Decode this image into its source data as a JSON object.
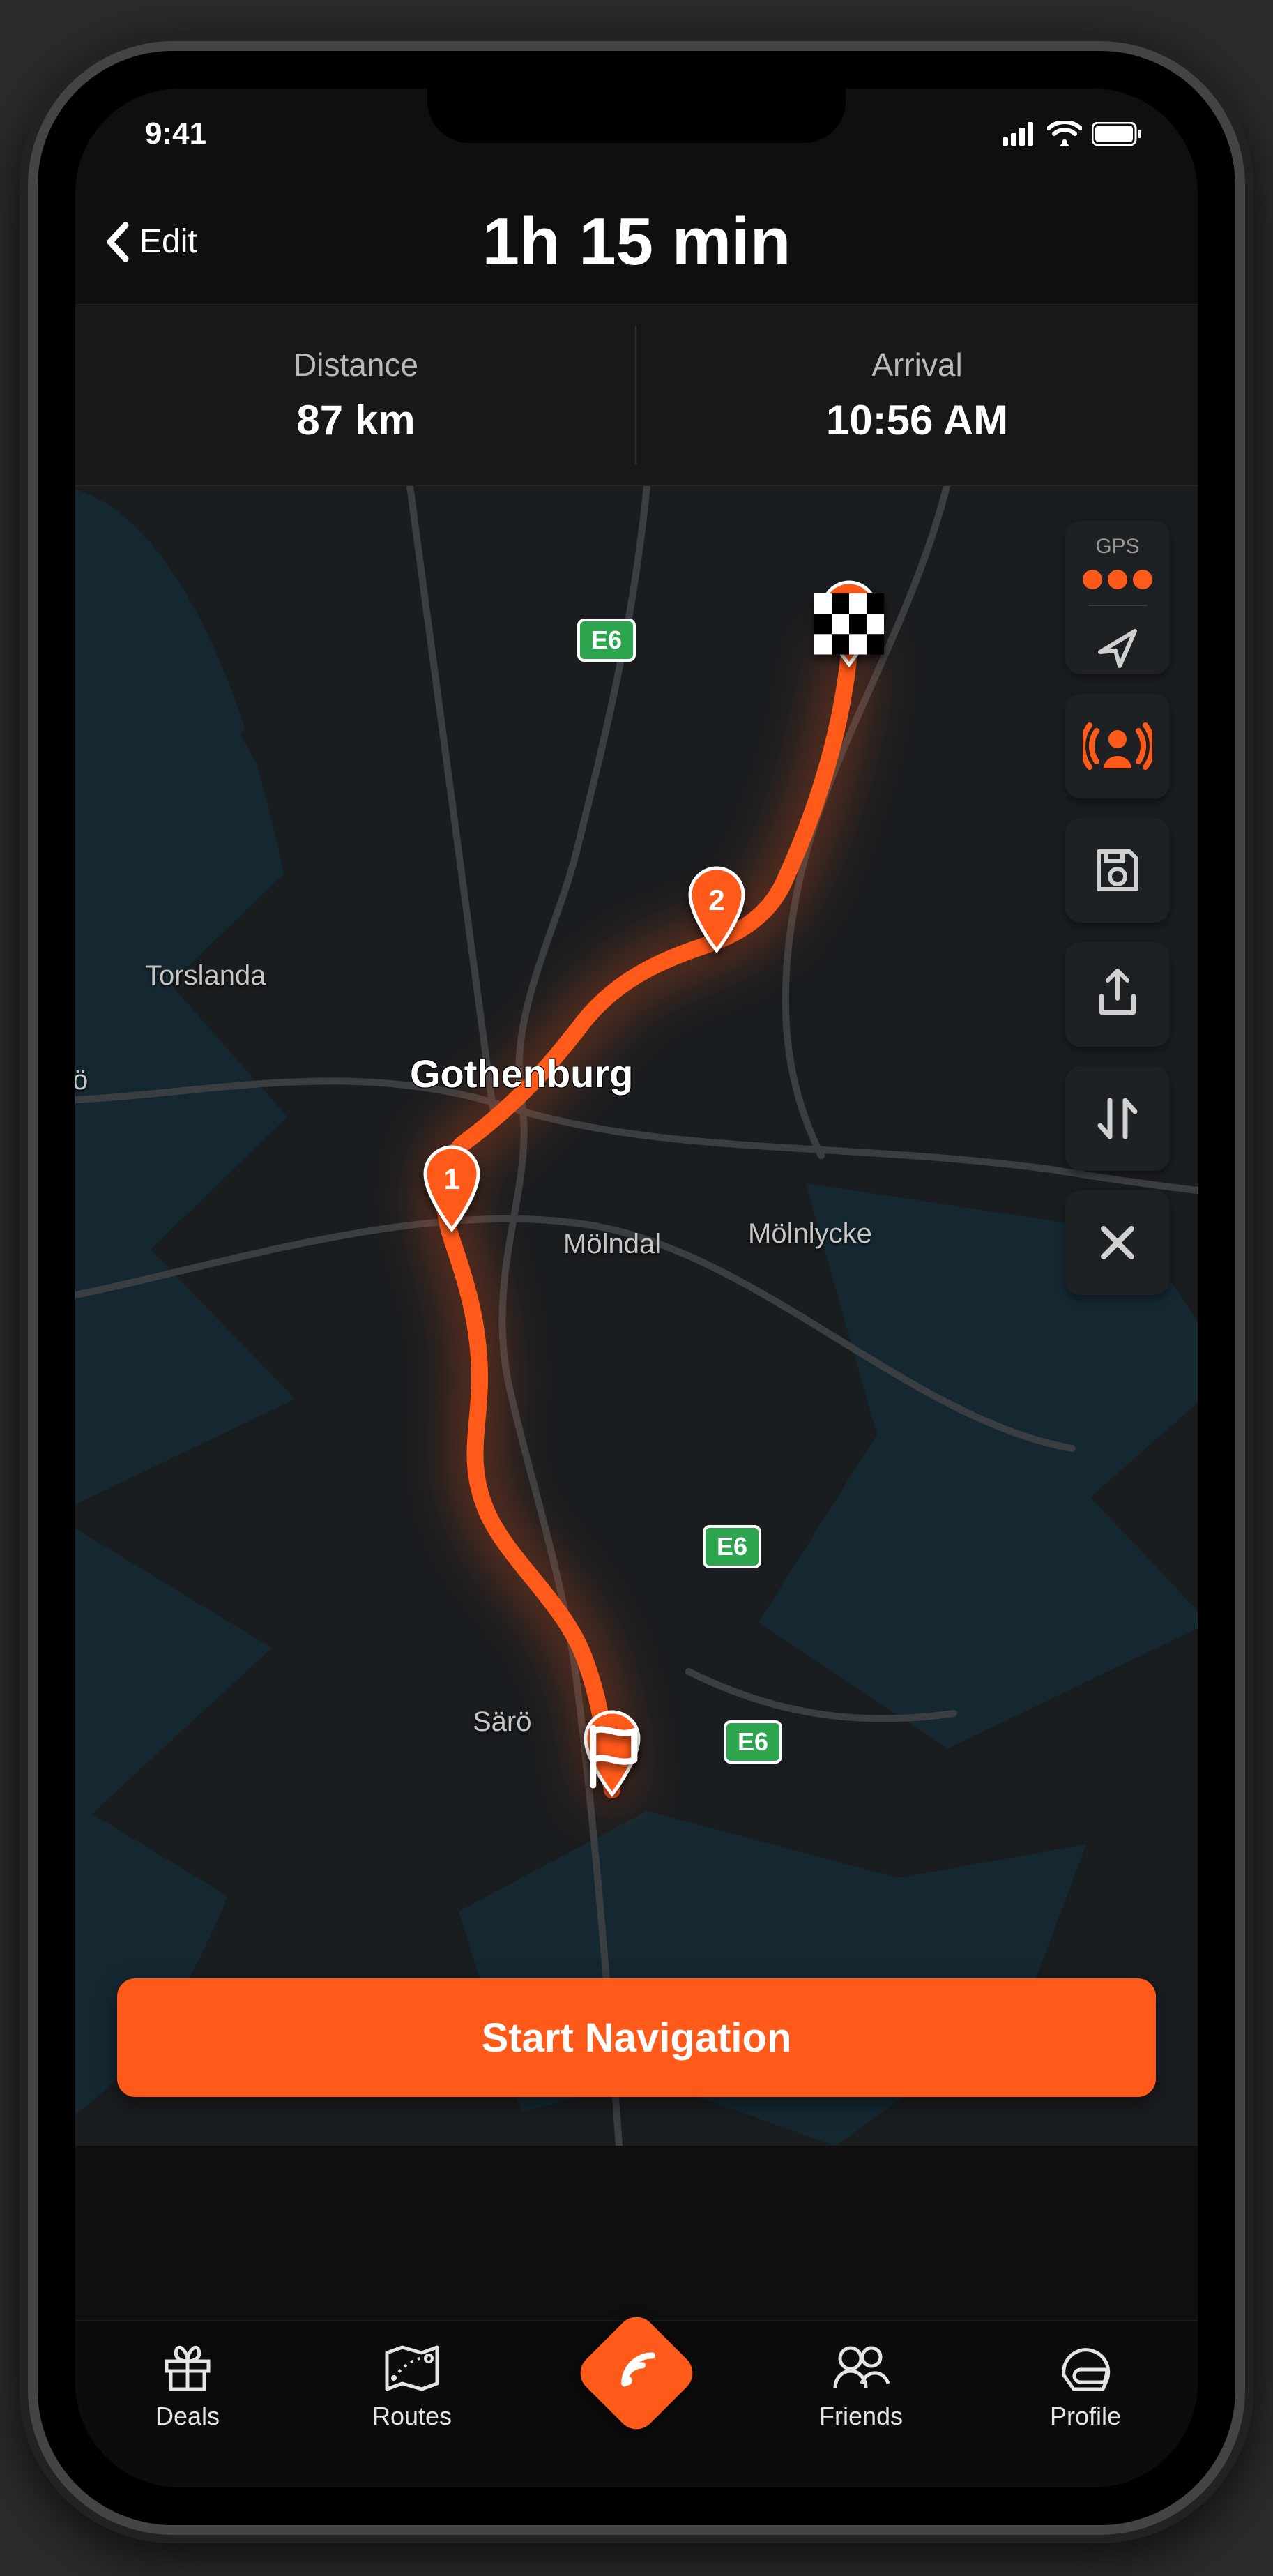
{
  "status": {
    "time": "9:41"
  },
  "header": {
    "back_label": "Edit",
    "title": "1h 15 min"
  },
  "info": {
    "distance_label": "Distance",
    "distance_value": "87 km",
    "arrival_label": "Arrival",
    "arrival_value": "10:56 AM"
  },
  "map": {
    "cities": {
      "gothenburg": "Gothenburg",
      "torslanda": "Torslanda",
      "molndal": "Mölndal",
      "molnlycke": "Mölnlycke",
      "saro": "Särö",
      "truncated": "ö"
    },
    "road_badge": "E6",
    "waypoints": {
      "wp1": "1",
      "wp2": "2"
    }
  },
  "gps": {
    "label": "GPS"
  },
  "actions": {
    "start_navigation": "Start Navigation"
  },
  "tabs": {
    "deals": "Deals",
    "routes": "Routes",
    "friends": "Friends",
    "profile": "Profile"
  }
}
